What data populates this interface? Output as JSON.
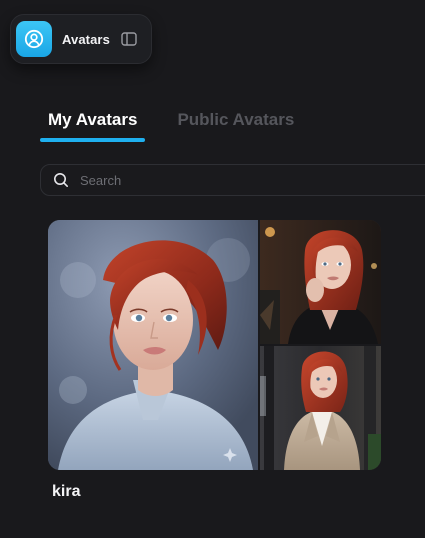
{
  "header": {
    "app_title": "Avatars",
    "app_icon": "avatar-user-icon",
    "toggle_icon": "sidebar-toggle-icon"
  },
  "tabs": [
    {
      "label": "My Avatars",
      "active": true
    },
    {
      "label": "Public Avatars",
      "active": false
    }
  ],
  "search": {
    "placeholder": "Search",
    "value": ""
  },
  "avatars": [
    {
      "name": "kira",
      "images": [
        "portrait-main",
        "portrait-cafe",
        "portrait-blazer"
      ]
    }
  ],
  "colors": {
    "background": "#19191c",
    "accent": "#1fb0ef",
    "inactive_tab": "#55565c"
  }
}
